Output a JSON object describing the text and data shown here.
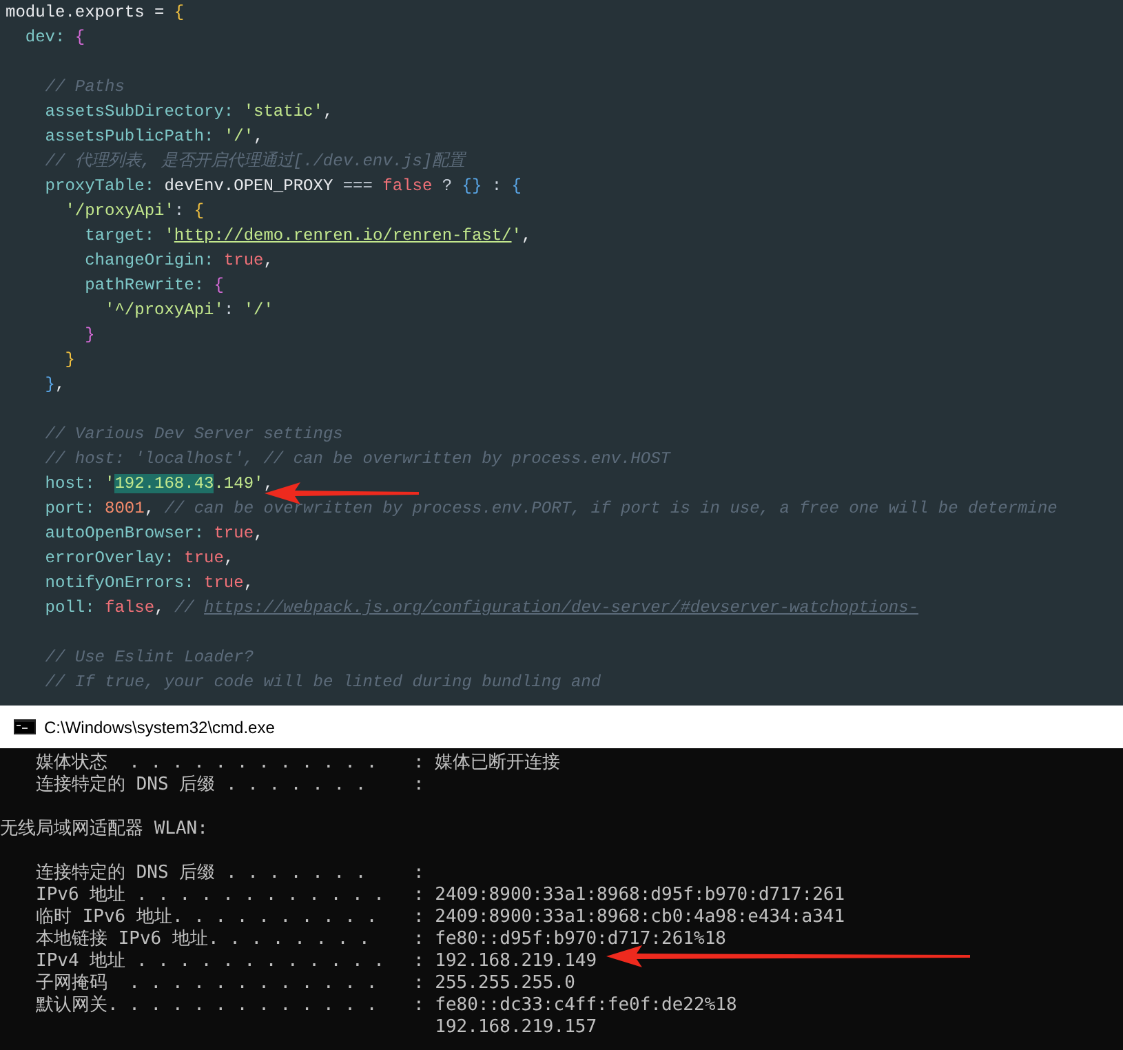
{
  "editor": {
    "blocks": [
      {
        "lines": [
          [
            {
              "kind": "plain",
              "text": "module.exports = "
            },
            {
              "kind": "brace",
              "text": "{"
            }
          ],
          [
            {
              "kind": "key",
              "text": "  dev: "
            },
            {
              "kind": "brace2",
              "text": "{"
            }
          ]
        ]
      },
      {
        "lines": [
          [
            {
              "kind": "comment",
              "text": "    // Paths"
            }
          ],
          [
            {
              "kind": "key",
              "text": "    assetsSubDirectory: "
            },
            {
              "kind": "str",
              "text": "'static'"
            },
            {
              "kind": "plain",
              "text": ","
            }
          ],
          [
            {
              "kind": "key",
              "text": "    assetsPublicPath: "
            },
            {
              "kind": "str",
              "text": "'/'"
            },
            {
              "kind": "plain",
              "text": ","
            }
          ],
          [
            {
              "kind": "comment",
              "text": "    // 代理列表, 是否开启代理通过[./dev.env.js]配置"
            }
          ],
          [
            {
              "kind": "key",
              "text": "    proxyTable: "
            },
            {
              "kind": "plain",
              "text": "devEnv.OPEN_PROXY "
            },
            {
              "kind": "op",
              "text": "=== "
            },
            {
              "kind": "kw",
              "text": "false"
            },
            {
              "kind": "op",
              "text": " ? "
            },
            {
              "kind": "brace3",
              "text": "{}"
            },
            {
              "kind": "op",
              "text": " : "
            },
            {
              "kind": "brace3",
              "text": "{"
            }
          ],
          [
            {
              "kind": "str",
              "text": "      '/proxyApi'"
            },
            {
              "kind": "op",
              "text": ": "
            },
            {
              "kind": "brace",
              "text": "{"
            }
          ],
          [
            {
              "kind": "key",
              "text": "        target: "
            },
            {
              "kind": "str",
              "text": "'"
            },
            {
              "kind": "link",
              "text": "http://demo.renren.io/renren-fast/"
            },
            {
              "kind": "str",
              "text": "'"
            },
            {
              "kind": "plain",
              "text": ","
            }
          ],
          [
            {
              "kind": "key",
              "text": "        changeOrigin: "
            },
            {
              "kind": "kw",
              "text": "true"
            },
            {
              "kind": "plain",
              "text": ","
            }
          ],
          [
            {
              "kind": "key",
              "text": "        pathRewrite: "
            },
            {
              "kind": "brace2",
              "text": "{"
            }
          ],
          [
            {
              "kind": "str",
              "text": "          '^/proxyApi'"
            },
            {
              "kind": "op",
              "text": ": "
            },
            {
              "kind": "str",
              "text": "'/'"
            }
          ],
          [
            {
              "kind": "brace2",
              "text": "        }"
            }
          ],
          [
            {
              "kind": "brace",
              "text": "      }"
            }
          ],
          [
            {
              "kind": "brace3",
              "text": "    }"
            },
            {
              "kind": "plain",
              "text": ","
            }
          ]
        ]
      },
      {
        "lines": [
          [
            {
              "kind": "comment",
              "text": "    // Various Dev Server settings"
            }
          ],
          [
            {
              "kind": "comment",
              "text": "    // host: 'localhost', // can be overwritten by process.env.HOST"
            }
          ],
          [
            {
              "kind": "key",
              "text": "    host: "
            },
            {
              "kind": "str",
              "text": "'"
            },
            {
              "kind": "highlight",
              "text": "192.168.43"
            },
            {
              "kind": "str",
              "text": ".149'"
            },
            {
              "kind": "plain",
              "text": ","
            }
          ],
          [
            {
              "kind": "key",
              "text": "    port: "
            },
            {
              "kind": "num",
              "text": "8001"
            },
            {
              "kind": "plain",
              "text": ", "
            },
            {
              "kind": "comment",
              "text": "// can be overwritten by process.env.PORT, if port is in use, a free one will be determine"
            }
          ],
          [
            {
              "kind": "key",
              "text": "    autoOpenBrowser: "
            },
            {
              "kind": "kw",
              "text": "true"
            },
            {
              "kind": "plain",
              "text": ","
            }
          ],
          [
            {
              "kind": "key",
              "text": "    errorOverlay: "
            },
            {
              "kind": "kw",
              "text": "true"
            },
            {
              "kind": "plain",
              "text": ","
            }
          ],
          [
            {
              "kind": "key",
              "text": "    notifyOnErrors: "
            },
            {
              "kind": "kw",
              "text": "true"
            },
            {
              "kind": "plain",
              "text": ","
            }
          ],
          [
            {
              "kind": "key",
              "text": "    poll: "
            },
            {
              "kind": "kw",
              "text": "false"
            },
            {
              "kind": "plain",
              "text": ", "
            },
            {
              "kind": "comment",
              "text": "// "
            },
            {
              "kind": "commentlink",
              "text": "https://webpack.js.org/configuration/dev-server/#devserver-watchoptions-"
            }
          ]
        ]
      },
      {
        "lines": [
          [
            {
              "kind": "comment",
              "text": "    // Use Eslint Loader?"
            }
          ],
          [
            {
              "kind": "comment",
              "text": "    // If true, your code will be linted during bundling and"
            }
          ]
        ]
      }
    ]
  },
  "console": {
    "title": "C:\\Windows\\system32\\cmd.exe",
    "sections": [
      {
        "lines": [
          {
            "label": "媒体状态  . . . . . . . . . . . .",
            "value": ": 媒体已断开连接"
          },
          {
            "label": "连接特定的 DNS 后缀 . . . . . . .",
            "value": ":"
          }
        ]
      },
      {
        "heading": "无线局域网适配器 WLAN:",
        "lines": [
          {
            "label": "连接特定的 DNS 后缀 . . . . . . .",
            "value": ":"
          },
          {
            "label": "IPv6 地址 . . . . . . . . . . . .",
            "value": ": 2409:8900:33a1:8968:d95f:b970:d717:261"
          },
          {
            "label": "临时 IPv6 地址. . . . . . . . . .",
            "value": ": 2409:8900:33a1:8968:cb0:4a98:e434:a341"
          },
          {
            "label": "本地链接 IPv6 地址. . . . . . . .",
            "value": ": fe80::d95f:b970:d717:261%18"
          },
          {
            "label": "IPv4 地址 . . . . . . . . . . . .",
            "value": ": 192.168.219.149"
          },
          {
            "label": "子网掩码  . . . . . . . . . . . .",
            "value": ": 255.255.255.0"
          },
          {
            "label": "默认网关. . . . . . . . . . . . .",
            "value": ": fe80::dc33:c4ff:fe0f:de22%18"
          },
          {
            "value": "  192.168.219.157"
          }
        ]
      }
    ]
  }
}
